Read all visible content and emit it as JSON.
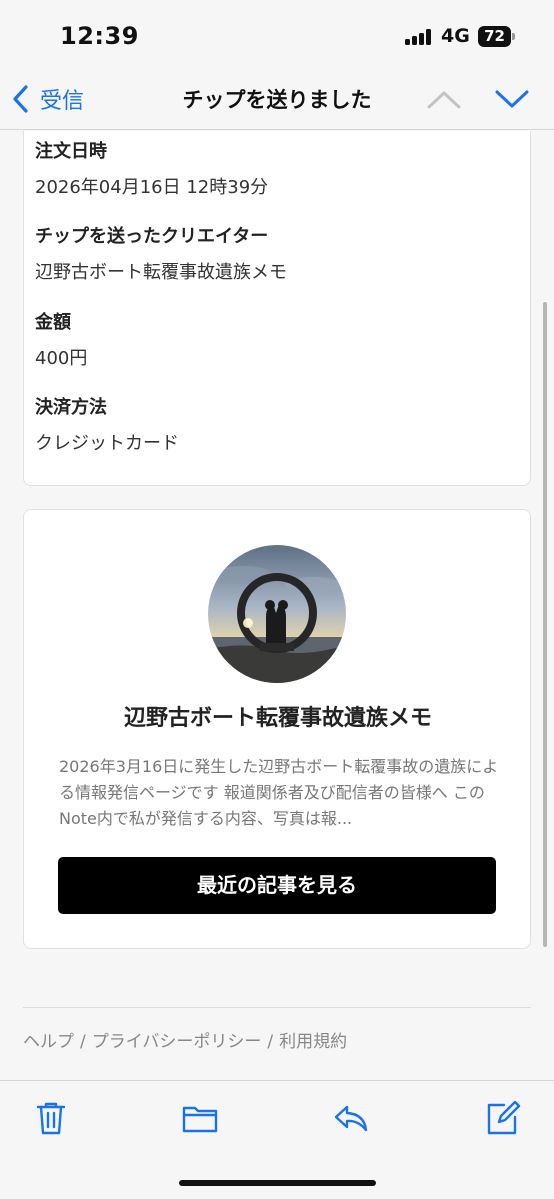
{
  "status_bar": {
    "time": "12:39",
    "network": "4G",
    "battery": "72"
  },
  "nav": {
    "back_label": "受信",
    "title": "チップを送りました",
    "icons": [
      "chevron-left-icon",
      "chevron-up-icon",
      "chevron-down-icon"
    ]
  },
  "details": [
    {
      "label": "注文日時",
      "value": "2026年04月16日 12時39分"
    },
    {
      "label": "チップを送ったクリエイター",
      "value": "辺野古ボート転覆事故遺族メモ"
    },
    {
      "label": "金額",
      "value": "400円"
    },
    {
      "label": "決済方法",
      "value": "クレジットカード"
    }
  ],
  "creator": {
    "name": "辺野古ボート転覆事故遺族メモ",
    "description": "2026年3月16日に発生した辺野古ボート転覆事故の遺族による情報発信ページです 報道関係者及び配信者の皆様へ このNote内で私が発信する内容、写真は報...",
    "button_label": "最近の記事を見る"
  },
  "footer": {
    "help": "ヘルプ",
    "privacy": "プライバシーポリシー",
    "terms": "利用規約",
    "separator": "/"
  },
  "toolbar": {
    "icons": [
      "trash-icon",
      "folder-icon",
      "reply-icon",
      "compose-icon"
    ]
  },
  "colors": {
    "accent": "#1a73e8",
    "button_bg": "#000000",
    "background": "#f6f6f6"
  }
}
